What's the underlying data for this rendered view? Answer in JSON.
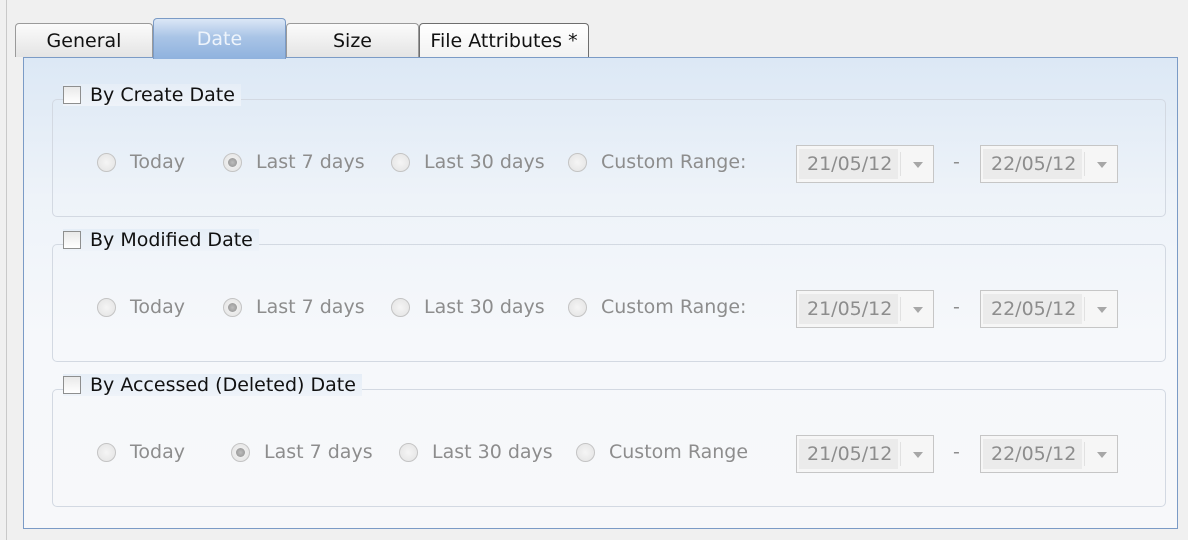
{
  "tabs": [
    {
      "label": "General",
      "active": false
    },
    {
      "label": "Date",
      "active": true
    },
    {
      "label": "Size",
      "active": false
    },
    {
      "label": "File Attributes *",
      "active": false
    }
  ],
  "groups": [
    {
      "title": "By Create Date",
      "checked": false,
      "options": [
        "Today",
        "Last 7 days",
        "Last 30 days",
        "Custom Range:"
      ],
      "selected": "Last 7 days",
      "from_date": "21/05/12",
      "to_date": "22/05/12",
      "range_separator": "-"
    },
    {
      "title": "By Modified Date",
      "checked": false,
      "options": [
        "Today",
        "Last 7 days",
        "Last 30 days",
        "Custom Range:"
      ],
      "selected": "Last 7 days",
      "from_date": "21/05/12",
      "to_date": "22/05/12",
      "range_separator": "-"
    },
    {
      "title": "By Accessed (Deleted) Date",
      "checked": false,
      "options": [
        "Today",
        "Last 7 days",
        "Last 30 days",
        "Custom Range"
      ],
      "selected": "Last 7 days",
      "from_date": "21/05/12",
      "to_date": "22/05/12",
      "range_separator": "-"
    }
  ],
  "colors": {
    "active_tab": "#a9c4e6",
    "panel_border": "#7b9bc6",
    "disabled_text": "#8d8d8d"
  }
}
